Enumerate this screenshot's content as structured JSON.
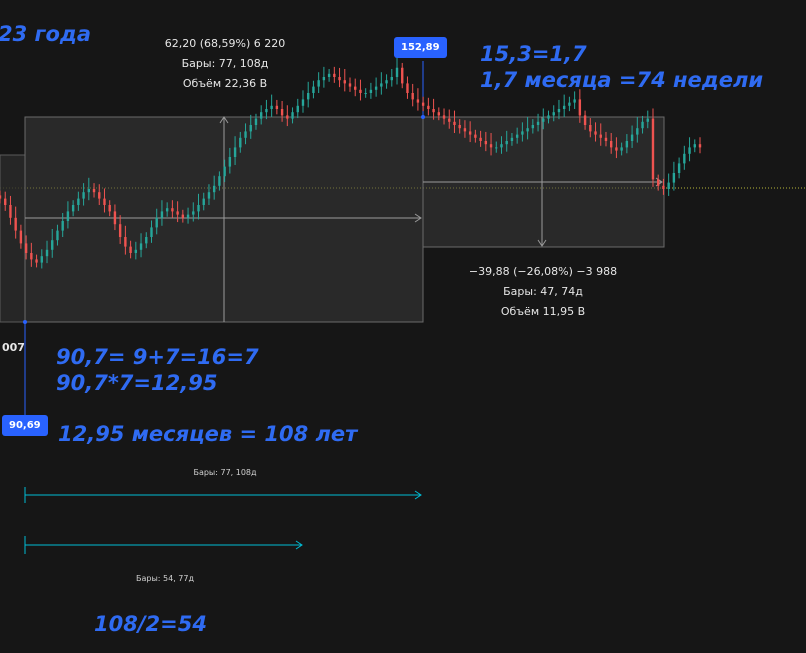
{
  "notes": {
    "top_left": "23 года",
    "top_right_1": "15,3=1,7",
    "top_right_2": "1,7 месяца =74 недели",
    "mid_1": "90,7= 9+7=16=7",
    "mid_2": "90,7*7=12,95",
    "mid_3": "12,95 месяцев = 108 лет",
    "bottom": "108/2=54"
  },
  "measure_up": {
    "change": "62,20 (68,59%) 6 220",
    "bars": "Бары: 77, 108д",
    "volume": "Объём 22,36 B"
  },
  "measure_down": {
    "change": "−39,88 (−26,08%) −3 988",
    "bars": "Бары: 47, 74д",
    "volume": "Объём 11,95 B"
  },
  "price_tags": {
    "high": "152,89",
    "low": "90,69"
  },
  "axis_fragment": "007",
  "rulers": {
    "long_label": "Бары: 77, 108д",
    "short_label": "Бары: 54, 77д"
  },
  "colors": {
    "background": "#161616",
    "up_candle": "#26a69a",
    "down_candle": "#ef5350",
    "annotation": "#2f6bf2",
    "ruler": "#00bcd4",
    "price_line": "#b5b53a"
  },
  "chart_data": {
    "type": "candlestick",
    "title": "",
    "series": [
      {
        "values": [
          112,
          110,
          106,
          102,
          98,
          95,
          93,
          92,
          94,
          96,
          99,
          102,
          105,
          108,
          110,
          112,
          114,
          115,
          114,
          112,
          110,
          108,
          104,
          100,
          97,
          95,
          96,
          98,
          100,
          103,
          106,
          108,
          109,
          108,
          107,
          106,
          107,
          108,
          110,
          112,
          114,
          116,
          119,
          122,
          125,
          128,
          131,
          133,
          135,
          137,
          139,
          140,
          141,
          140,
          138,
          137,
          139,
          141,
          143,
          145,
          147,
          149,
          150,
          151,
          150,
          149,
          148,
          147,
          146,
          145,
          145,
          146,
          147,
          148,
          149,
          150,
          152.89,
          148,
          145,
          143,
          142,
          141,
          140,
          139,
          138,
          137,
          136,
          135,
          134,
          133,
          132,
          131,
          130,
          129,
          128,
          128,
          129,
          130,
          131,
          132,
          133,
          134,
          135,
          136,
          137,
          138,
          139,
          140,
          141,
          142,
          143,
          138,
          135,
          133,
          132,
          131,
          130,
          128,
          127,
          128,
          130,
          132,
          134,
          136,
          137,
          118,
          116,
          115,
          117,
          120,
          123,
          126,
          128,
          129,
          128
        ]
      }
    ],
    "ylim": [
      85,
      160
    ]
  }
}
